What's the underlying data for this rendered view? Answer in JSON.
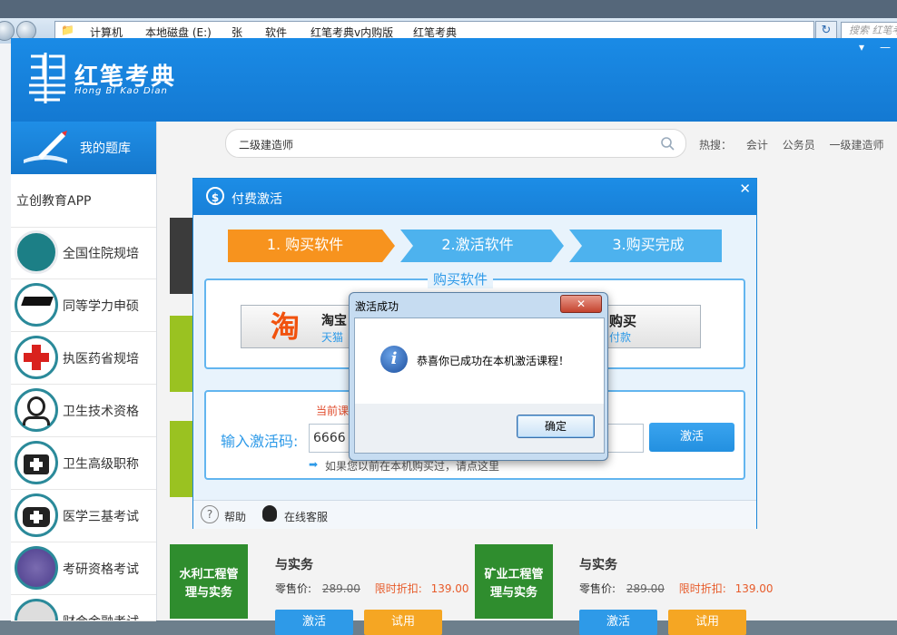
{
  "explorer": {
    "breadcrumb": [
      "计算机",
      "本地磁盘 (E:)",
      "张",
      "软件",
      "红笔考典v内购版",
      "红笔考典"
    ],
    "search_placeholder": "搜索 红笔考典"
  },
  "app": {
    "logo_title": "红笔考典",
    "logo_subtitle": "Hong Bi Kao Dian",
    "my_bank": "我的题库",
    "search_value": "二级建造师",
    "hot_label": "热搜：",
    "hot_terms": [
      "会计",
      "公务员",
      "一级建造师"
    ],
    "sidebar_first": "立创教育APP",
    "sidebar_items": [
      "全国住院规培",
      "同等学力申硕",
      "执医药省规培",
      "卫生技术资格",
      "卫生高级职称",
      "医学三基考试",
      "考研资格考试",
      "财会金融考试"
    ]
  },
  "courses": [
    {
      "card": "水利工程管理与实务",
      "title": "与实务",
      "retail_label": "零售价:",
      "retail": "289.00",
      "sale_label": "限时折扣:",
      "sale": "139.00",
      "activate": "激活",
      "trial": "试用"
    },
    {
      "card": "矿业工程管理与实务",
      "title": "与实务",
      "retail_label": "零售价:",
      "retail": "289.00",
      "sale_label": "限时折扣:",
      "sale": "139.00",
      "activate": "激活",
      "trial": "试用"
    }
  ],
  "pay_dialog": {
    "title": "付费激活",
    "steps": [
      "1. 购买软件",
      "2.激活软件",
      "3.购买完成"
    ],
    "buy_section": "购买软件",
    "taobao_name": "淘宝",
    "taobao_sub": "天猫",
    "alipay_name": "购买",
    "alipay_sub": "付款",
    "current_label": "当前课",
    "code_label": "输入激活码:",
    "code_value": "6666",
    "activate": "激活",
    "hint": "如果您以前在本机购买过，请点这里",
    "help": "帮助",
    "service": "在线客服"
  },
  "msg_dialog": {
    "title": "激活成功",
    "text": "恭喜你已成功在本机激活课程！",
    "ok": "确定"
  }
}
